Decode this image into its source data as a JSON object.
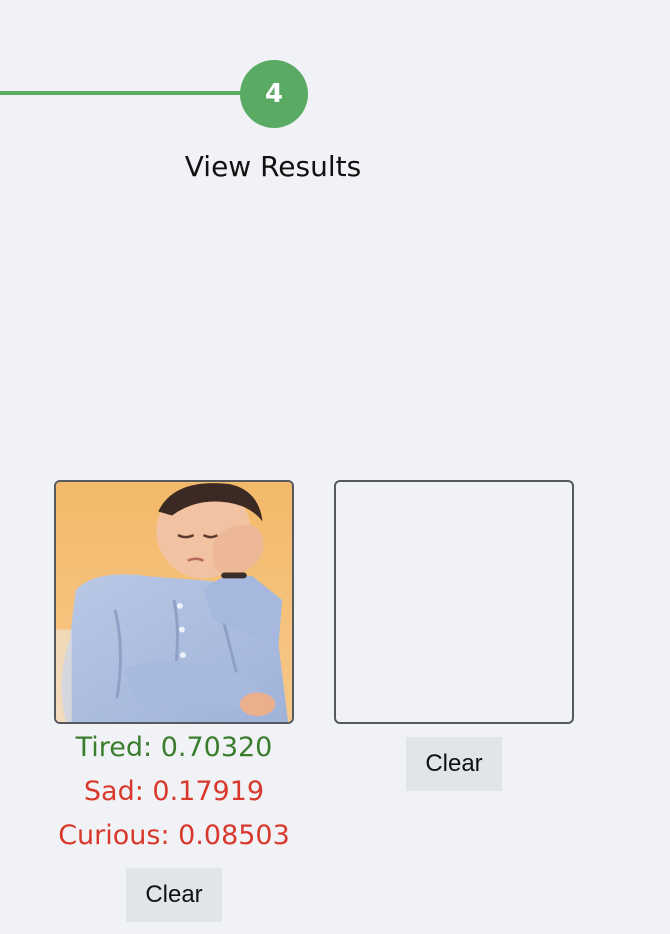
{
  "stepper": {
    "step_number": "4",
    "step_label": "View Results",
    "accent_color": "#5aaa64"
  },
  "cards": [
    {
      "has_image": true,
      "image_description_icon": "photo-tired-boy-icon",
      "results": [
        {
          "label": "Tired: 0.70320",
          "color": "#3a7d2c"
        },
        {
          "label": "Sad: 0.17919",
          "color": "#d9382c"
        },
        {
          "label": "Curious: 0.08503",
          "color": "#d9382c"
        }
      ],
      "clear_label": "Clear"
    },
    {
      "has_image": false,
      "results": [],
      "clear_label": "Clear"
    }
  ]
}
